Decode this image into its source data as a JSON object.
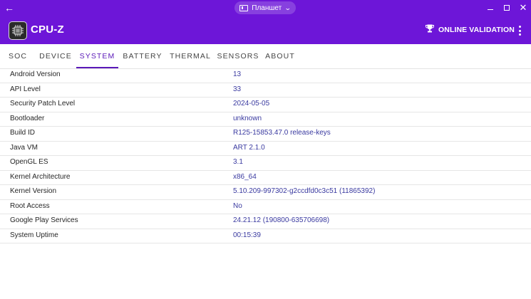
{
  "window": {
    "mode_label": "Планшет",
    "icons": {
      "back": "arrow-left-icon",
      "mode": "tablet-icon",
      "dropdown": "chevron-down-icon",
      "minimize": "minimize-icon",
      "maximize": "maximize-icon",
      "close": "close-icon"
    }
  },
  "appbar": {
    "title": "CPU-Z",
    "validation_label": "ONLINE VALIDATION",
    "icons": {
      "logo": "cpu-chip-icon",
      "validation": "trophy-icon",
      "menu": "more-vertical-icon"
    },
    "colors": {
      "bar": "#6d16d8",
      "accent": "#5a18b8"
    }
  },
  "tabs": [
    {
      "label": "SOC",
      "active": false
    },
    {
      "label": "DEVICE",
      "active": false
    },
    {
      "label": "SYSTEM",
      "active": true
    },
    {
      "label": "BATTERY",
      "active": false
    },
    {
      "label": "THERMAL",
      "active": false
    },
    {
      "label": "SENSORS",
      "active": false
    },
    {
      "label": "ABOUT",
      "active": false
    }
  ],
  "system_info": [
    {
      "key": "Android Version",
      "value": "13"
    },
    {
      "key": "API Level",
      "value": "33"
    },
    {
      "key": "Security Patch Level",
      "value": "2024-05-05"
    },
    {
      "key": "Bootloader",
      "value": "unknown"
    },
    {
      "key": "Build ID",
      "value": "R125-15853.47.0 release-keys"
    },
    {
      "key": "Java VM",
      "value": "ART 2.1.0"
    },
    {
      "key": "OpenGL ES",
      "value": "3.1"
    },
    {
      "key": "Kernel Architecture",
      "value": "x86_64"
    },
    {
      "key": "Kernel Version",
      "value": "5.10.209-997302-g2ccdfd0c3c51 (11865392)"
    },
    {
      "key": "Root Access",
      "value": "No"
    },
    {
      "key": "Google Play Services",
      "value": "24.21.12 (190800-635706698)"
    },
    {
      "key": "System Uptime",
      "value": "00:15:39"
    }
  ]
}
